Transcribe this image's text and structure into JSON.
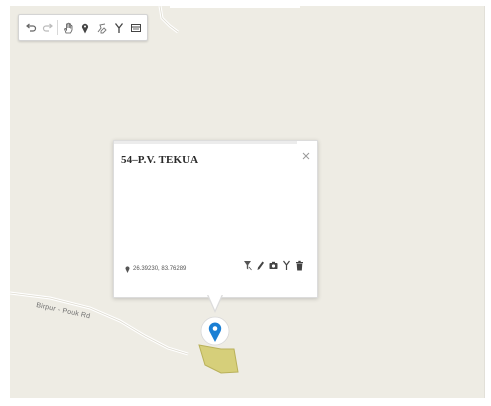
{
  "toolbar": {
    "buttons": [
      {
        "name": "undo",
        "icon": "undo-icon"
      },
      {
        "name": "redo",
        "icon": "redo-icon"
      },
      {
        "name": "pan",
        "icon": "hand-icon"
      },
      {
        "name": "add-point",
        "icon": "map-pin-icon"
      },
      {
        "name": "draw-line",
        "icon": "draw-line-icon"
      },
      {
        "name": "split",
        "icon": "split-icon"
      },
      {
        "name": "layers",
        "icon": "layers-icon"
      }
    ]
  },
  "map": {
    "road_label": "Birpur - Pouk Rd",
    "colors": {
      "background": "#eeece4",
      "road": "#ffffff",
      "parcel": "#d6cf7a",
      "marker": "#1a7fd4"
    }
  },
  "popup": {
    "title": "54–P.V. TEKUA",
    "coordinates": "26.39230, 83.76289",
    "actions": [
      {
        "name": "filter",
        "icon": "filter-icon"
      },
      {
        "name": "edit",
        "icon": "pencil-icon"
      },
      {
        "name": "photo",
        "icon": "camera-icon"
      },
      {
        "name": "split",
        "icon": "split-icon"
      },
      {
        "name": "delete",
        "icon": "trash-icon"
      }
    ]
  }
}
